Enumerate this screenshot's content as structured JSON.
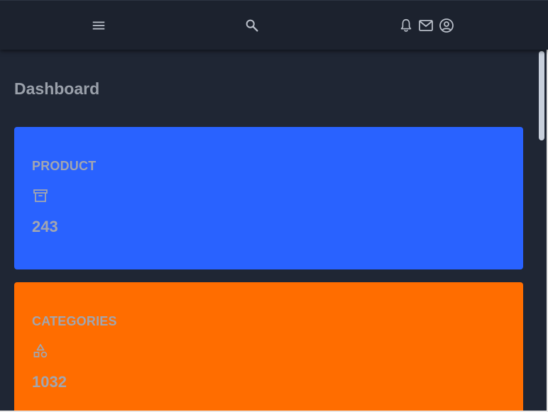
{
  "topbar": {
    "icons": {
      "menu": "menu-icon",
      "search": "search-icon",
      "bell": "bell-icon",
      "mail": "mail-icon",
      "user": "user-circle-icon"
    }
  },
  "page": {
    "title": "Dashboard"
  },
  "cards": [
    {
      "label": "PRODUCT",
      "value": "243",
      "icon": "archive-icon",
      "color": "#2962ff"
    },
    {
      "label": "CATEGORIES",
      "value": "1032",
      "icon": "shapes-icon",
      "color": "#ff6d00"
    }
  ],
  "colors": {
    "background": "#1f2634",
    "topbar": "#1c222e",
    "text_muted": "#a2a6b0"
  }
}
